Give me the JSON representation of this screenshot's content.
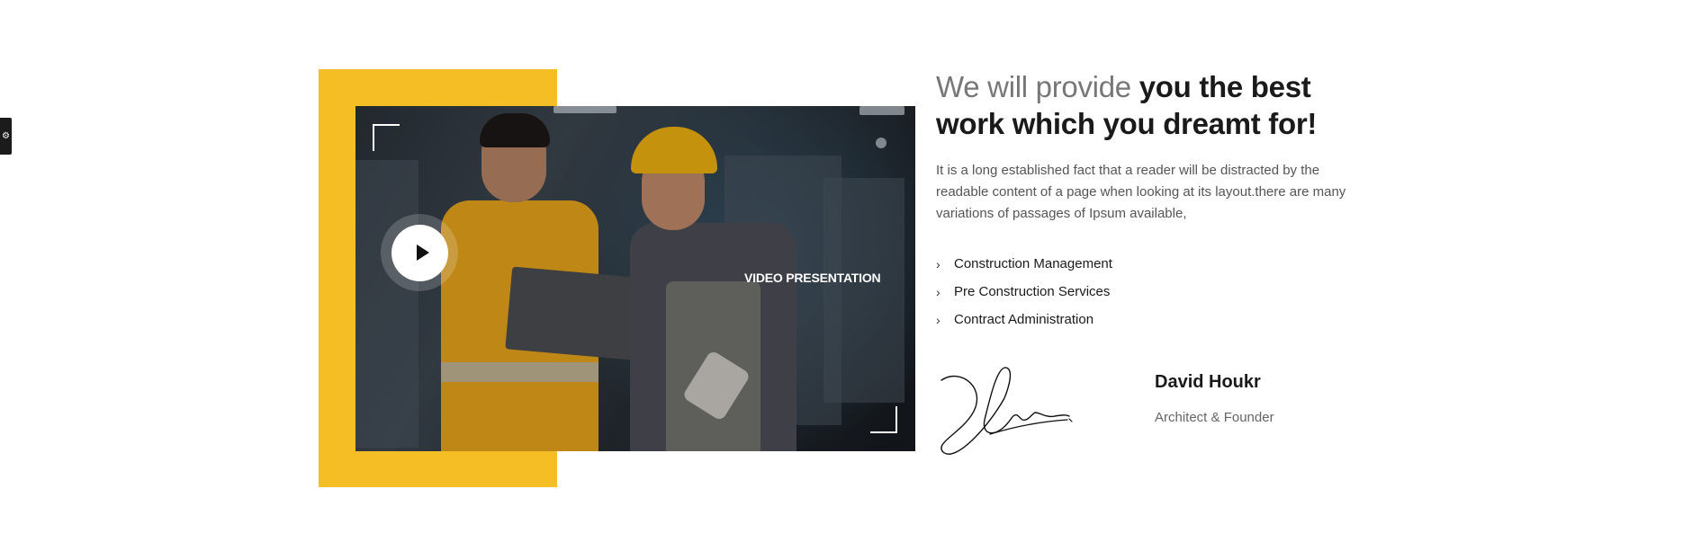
{
  "side_tab": {
    "icon": "gear-icon"
  },
  "video": {
    "label": "VIDEO PRESENTATION",
    "play_icon": "play-icon",
    "accent_color": "#f5be25"
  },
  "content": {
    "heading_light": "We will provide",
    "heading_bold": "you the best work which you dreamt for!",
    "description": "It is a long established fact that a reader will be distracted by the readable content of a page when looking at its layout.there are many variations of passages of Ipsum available,",
    "services": [
      "Construction Management",
      "Pre Construction Services",
      "Contract Administration"
    ],
    "author": {
      "name": "David Houkr",
      "role": "Architect & Founder"
    }
  }
}
